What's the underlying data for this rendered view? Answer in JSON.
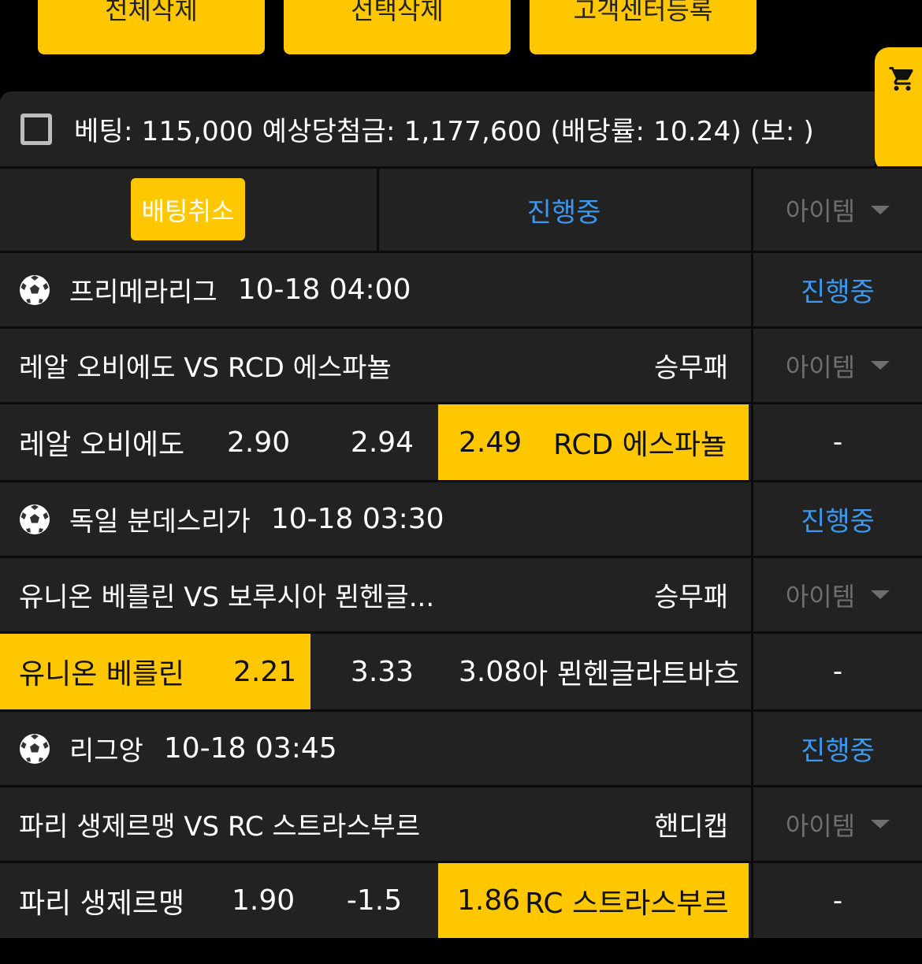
{
  "top_buttons": {
    "delete_all": "전체삭제",
    "delete_selected": "선택삭제",
    "cs_register": "고객센터등록"
  },
  "cart": {
    "icon": "cart-icon"
  },
  "summary": {
    "text": "베팅: 115,000 예상당첨금: 1,177,600 (배당률: 10.24) (보: )"
  },
  "tabs": {
    "cancel_label": "배팅취소",
    "status_label": "진행중",
    "item_label": "아이템"
  },
  "matches": [
    {
      "league": "프리메라리그",
      "time": "10-18 04:00",
      "status": "진행중",
      "title": "레알 오비에도 VS RCD 에스파뇰",
      "bet_type": "승무패",
      "item_label": "아이템",
      "home": "레알 오비에도",
      "home_odds": "2.90",
      "draw": "2.94",
      "away_odds": "2.49",
      "away": "RCD 에스파뇰",
      "selected": "away",
      "extra": "-"
    },
    {
      "league": "독일 분데스리가",
      "time": "10-18 03:30",
      "status": "진행중",
      "title": "유니온 베를린 VS 보루시아 묀헨글...",
      "bet_type": "승무패",
      "item_label": "아이템",
      "home": "유니온 베를린",
      "home_odds": "2.21",
      "draw": "3.33",
      "away_odds": "3.08",
      "away": "아 묀헨글라트바흐",
      "selected": "home",
      "extra": "-"
    },
    {
      "league": "리그앙",
      "time": "10-18 03:45",
      "status": "진행중",
      "title": "파리 생제르맹 VS RC 스트라스부르",
      "bet_type": "핸디캡",
      "item_label": "아이템",
      "home": "파리 생제르맹",
      "home_odds": "1.90",
      "draw": "-1.5",
      "away_odds": "1.86",
      "away": "RC 스트라스부르",
      "selected": "away",
      "extra": "-"
    }
  ],
  "colors": {
    "accent": "#FFC700",
    "status_blue": "#3A98F0",
    "panel_bg": "#222222"
  }
}
